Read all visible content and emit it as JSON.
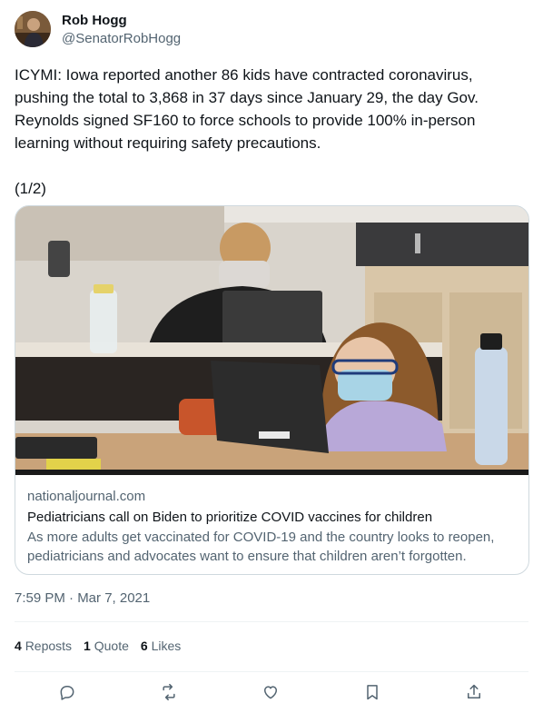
{
  "author": {
    "name": "Rob Hogg",
    "handle": "@SenatorRobHogg"
  },
  "tweet": {
    "text": "ICYMI: Iowa reported another 86 kids have contracted coronavirus, pushing the total to 3,868 in 37 days since January 29, the day Gov. Reynolds signed SF160 to force schools to provide 100% in-person learning without requiring safety precautions.",
    "thread_part": "(1/2)",
    "timestamp": "7:59 PM · Mar 7, 2021"
  },
  "card": {
    "domain": "nationaljournal.com",
    "title": "Pediatricians call on Biden to prioritize COVID vaccines for children",
    "description": "As more adults get vaccinated for COVID-19 and the country looks to reopen, pediatricians and advocates want to ensure that children aren’t forgotten."
  },
  "stats": {
    "reposts_count": "4",
    "reposts_label": "Reposts",
    "quotes_count": "1",
    "quotes_label": "Quote",
    "likes_count": "6",
    "likes_label": "Likes"
  },
  "actions": [
    "reply-icon",
    "repost-icon",
    "like-icon",
    "bookmark-icon",
    "share-icon"
  ],
  "colors": {
    "text": "#0f1419",
    "secondary": "#536471",
    "border": "#cfd9de",
    "divider": "#eff3f4"
  }
}
